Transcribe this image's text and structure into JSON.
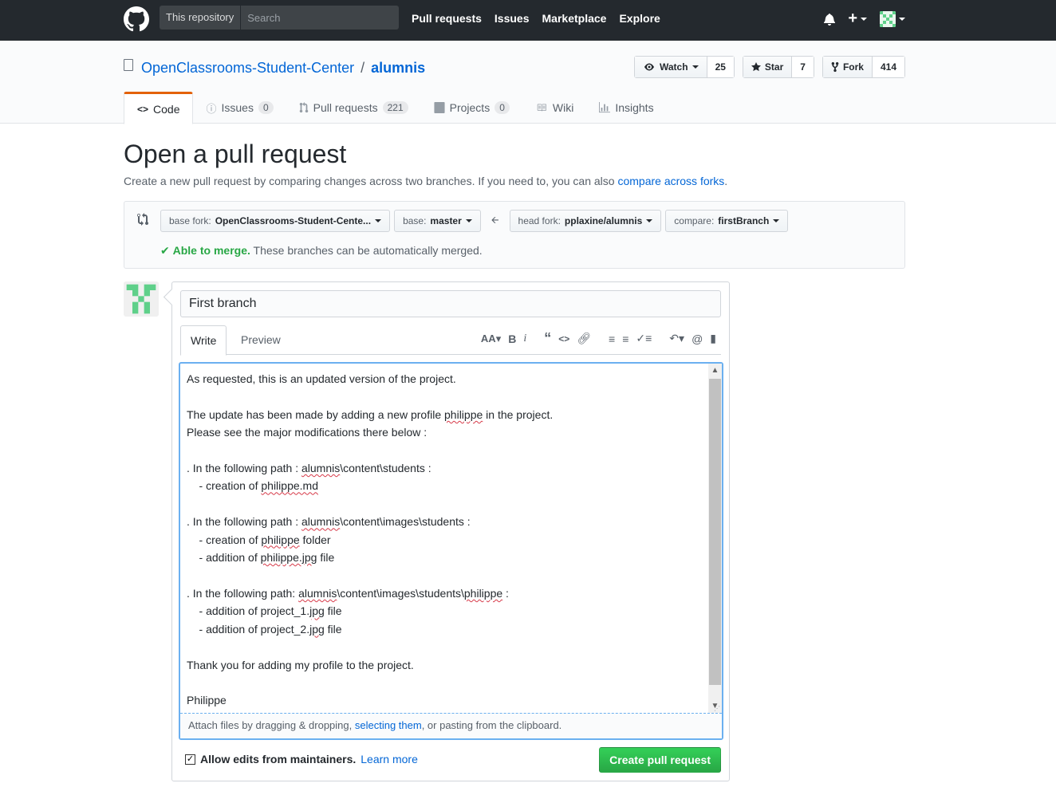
{
  "header": {
    "scope_label": "This repository",
    "search_placeholder": "Search",
    "nav": [
      "Pull requests",
      "Issues",
      "Marketplace",
      "Explore"
    ],
    "new_label": "+"
  },
  "repo": {
    "owner": "OpenClassrooms-Student-Center",
    "separator": "/",
    "name": "alumnis",
    "watch_label": "Watch",
    "watch_count": "25",
    "star_label": "Star",
    "star_count": "7",
    "fork_label": "Fork",
    "fork_count": "414",
    "tabs": [
      {
        "label": "Code",
        "icon": "<>",
        "count": ""
      },
      {
        "label": "Issues",
        "icon": "!",
        "count": "0"
      },
      {
        "label": "Pull requests",
        "icon": "pr",
        "count": "221"
      },
      {
        "label": "Projects",
        "icon": "proj",
        "count": "0"
      },
      {
        "label": "Wiki",
        "icon": "wiki",
        "count": ""
      },
      {
        "label": "Insights",
        "icon": "graph",
        "count": ""
      }
    ]
  },
  "page": {
    "title": "Open a pull request",
    "description": "Create a new pull request by comparing changes across two branches. If you need to, you can also",
    "description_link": "compare across forks",
    "description_end": "."
  },
  "range": {
    "base_fork_prefix": "base fork:",
    "base_fork": "OpenClassrooms-Student-Cente...",
    "base_prefix": "base:",
    "base": "master",
    "head_fork_prefix": "head fork:",
    "head_fork": "pplaxine/alumnis",
    "compare_prefix": "compare:",
    "compare": "firstBranch",
    "merge_ok": "Able to merge.",
    "merge_msg": "These branches can be automatically merged."
  },
  "form": {
    "title_value": "First branch",
    "tab_write": "Write",
    "tab_preview": "Preview",
    "attach_prefix": "Attach files by dragging & dropping,",
    "attach_link": "selecting them",
    "attach_suffix": ", or pasting from the clipboard.",
    "allow_edits": "Allow edits from maintainers.",
    "learn_more": "Learn more",
    "submit": "Create pull request",
    "body_lines": [
      "As requested, this is an updated version of the project.",
      "",
      "The update has been made by adding a new profile philippe in the project.",
      "Please see the major modifications there below :",
      "",
      ". In the following path : alumnis\\content\\students :",
      "    - creation of philippe.md",
      "",
      ". In the following path : alumnis\\content\\images\\students :",
      "    - creation of philippe folder",
      "    - addition of philippe.jpg file",
      "",
      ". In the following path: alumnis\\content\\images\\students\\philippe :",
      "    - addition of project_1.jpg file",
      "    - addition of project_2.jpg file",
      "",
      "Thank you for adding my profile to the project.",
      "",
      "Philippe"
    ]
  },
  "colors": {
    "header_bg": "#24292e",
    "link": "#0366d6",
    "success": "#28a745",
    "tab_accent": "#e36209"
  }
}
